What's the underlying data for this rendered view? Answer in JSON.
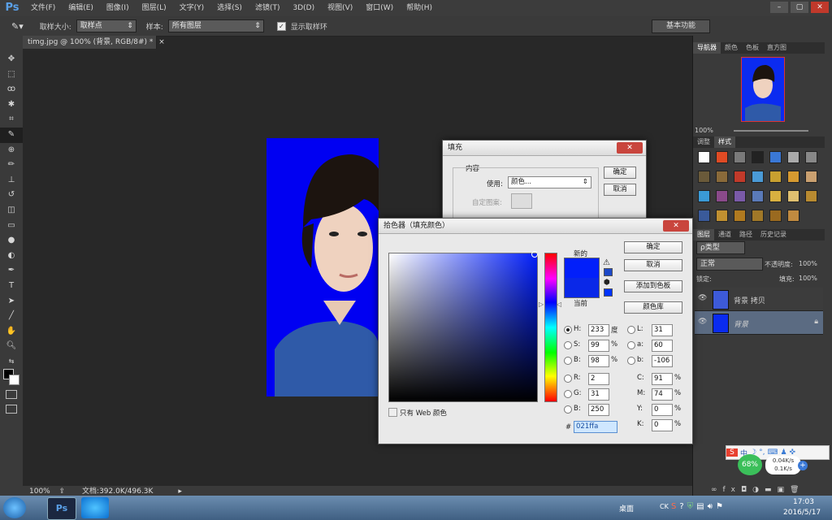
{
  "app": {
    "logo": "Ps"
  },
  "menu": [
    "文件(F)",
    "编辑(E)",
    "图像(I)",
    "图层(L)",
    "文字(Y)",
    "选择(S)",
    "滤镜(T)",
    "3D(D)",
    "视图(V)",
    "窗口(W)",
    "帮助(H)"
  ],
  "window_controls": {
    "minimize": "–",
    "restore": "▢",
    "close": "✕"
  },
  "options": {
    "sample_size_label": "取样大小:",
    "sample_size_value": "取样点",
    "sample_label": "样本:",
    "sample_value": "所有图层",
    "show_ring_label": "显示取样环",
    "workspace": "基本功能"
  },
  "document": {
    "tab": "timg.jpg @ 100% (背景, RGB/8#) *",
    "zoom": "100%",
    "doc_size": "文档:392.0K/496.3K"
  },
  "navigator": {
    "tabs": [
      "导航器",
      "颜色",
      "色板",
      "直方图"
    ],
    "zoom": "100%"
  },
  "styles": {
    "tabs": [
      "调整",
      "样式"
    ]
  },
  "layers": {
    "tabs": [
      "图层",
      "通道",
      "路径",
      "历史记录"
    ],
    "kind_label": "ρ类型",
    "blend_mode": "正常",
    "opacity_label": "不透明度:",
    "opacity_value": "100%",
    "lock_label": "锁定:",
    "fill_label": "填充:",
    "fill_value": "100%",
    "items": [
      {
        "name": "背景 拷贝",
        "selected": false
      },
      {
        "name": "背景",
        "selected": true
      }
    ]
  },
  "fill_dialog": {
    "title": "填充",
    "content_group": "内容",
    "use_label": "使用:",
    "use_value": "颜色...",
    "custom_pattern_label": "自定图案:",
    "ok": "确定",
    "cancel": "取消"
  },
  "picker_dialog": {
    "title": "拾色器（填充颜色）",
    "new_label": "新的",
    "current_label": "当前",
    "ok": "确定",
    "cancel": "取消",
    "add_to_swatches": "添加到色板",
    "color_libraries": "颜色库",
    "web_only_label": "只有 Web 颜色",
    "hsb": [
      {
        "label": "H:",
        "value": "233",
        "unit": "度"
      },
      {
        "label": "S:",
        "value": "99",
        "unit": "%"
      },
      {
        "label": "B:",
        "value": "98",
        "unit": "%"
      }
    ],
    "rgb": [
      {
        "label": "R:",
        "value": "2"
      },
      {
        "label": "G:",
        "value": "31"
      },
      {
        "label": "B:",
        "value": "250"
      }
    ],
    "lab": [
      {
        "label": "L:",
        "value": "31"
      },
      {
        "label": "a:",
        "value": "60"
      },
      {
        "label": "b:",
        "value": "-106"
      }
    ],
    "cmyk": [
      {
        "label": "C:",
        "value": "91",
        "unit": "%"
      },
      {
        "label": "M:",
        "value": "74",
        "unit": "%"
      },
      {
        "label": "Y:",
        "value": "0",
        "unit": "%"
      },
      {
        "label": "K:",
        "value": "0",
        "unit": "%"
      }
    ],
    "hex_label": "#",
    "hex": "021ffa",
    "new_color": "#021ffa",
    "current_color": "#0a28e8"
  },
  "ime_widget": {
    "percent": "68%",
    "upload": "0.04K/s",
    "download": "0.1K/s",
    "label": "中"
  },
  "taskbar": {
    "desktop_label": "桌面",
    "time": "17:03",
    "date": "2016/5/17",
    "tray_ck": "CK"
  }
}
